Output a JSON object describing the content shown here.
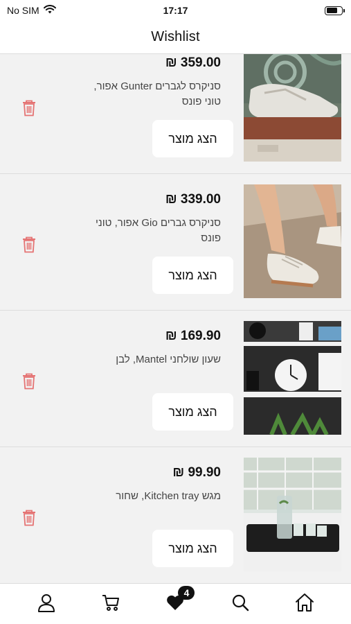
{
  "status_bar": {
    "carrier": "No SIM",
    "time": "17:17",
    "battery_level": 0.75
  },
  "header": {
    "title": "Wishlist"
  },
  "items": [
    {
      "price": "₪ 359.00",
      "title": "סניקרס לגברים Gunter אפור, טוני פונס",
      "button_label": "הצג מוצר",
      "image": "sneaker-on-ledge"
    },
    {
      "price": "₪ 339.00",
      "title": "סניקרס גברים Gio אפור, טוני פונס",
      "button_label": "הצג מוצר",
      "image": "sneakers-on-feet"
    },
    {
      "price": "₪ 169.90",
      "title": "שעון שולחני Mantel, לבן",
      "button_label": "הצג מוצר",
      "image": "white-table-clock"
    },
    {
      "price": "₪ 99.90",
      "title": "מגש Kitchen tray, שחור",
      "button_label": "הצג מוצר",
      "image": "black-kitchen-tray"
    }
  ],
  "tab_bar": {
    "tabs": [
      "profile",
      "cart",
      "wishlist",
      "search",
      "home"
    ],
    "wishlist_badge": "4"
  },
  "colors": {
    "trash": "#e57373",
    "background": "#f2f2f2",
    "button_bg": "#ffffff"
  }
}
